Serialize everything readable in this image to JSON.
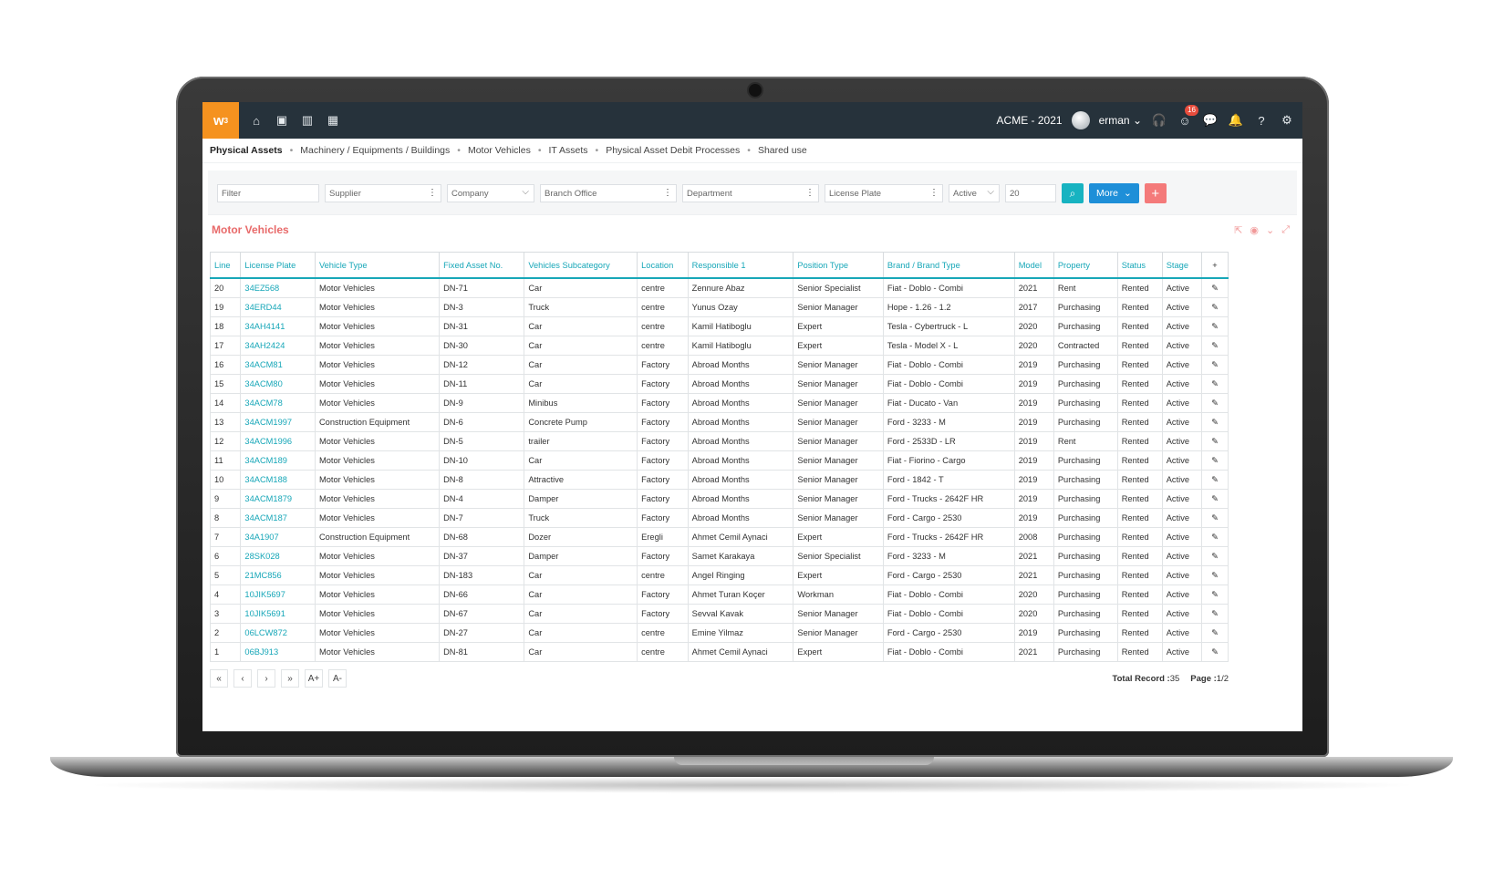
{
  "app": {
    "logo_text": "w",
    "logo_sup": "3",
    "company": "ACME - 2021",
    "user": "erman",
    "notifications": "16"
  },
  "nav_icons": [
    "home-icon",
    "briefcase-icon",
    "bar-chart-icon",
    "calendar-icon"
  ],
  "breadcrumb": [
    "Physical Assets",
    "Machinery / Equipments / Buildings",
    "Motor Vehicles",
    "IT Assets",
    "Physical Asset Debit Processes",
    "Shared use"
  ],
  "filters": {
    "filter": "Filter",
    "supplier": "Supplier",
    "company": "Company",
    "branch": "Branch Office",
    "department": "Department",
    "plate": "License Plate",
    "status": "Active",
    "page_size": "20",
    "more_label": "More"
  },
  "panel": {
    "title": "Motor Vehicles"
  },
  "table": {
    "headers": [
      "Line",
      "License Plate",
      "Vehicle Type",
      "Fixed Asset No.",
      "Vehicles Subcategory",
      "Location",
      "Responsible 1",
      "Position Type",
      "Brand / Brand Type",
      "Model",
      "Property",
      "Status",
      "Stage"
    ],
    "rows": [
      [
        "20",
        "34EZ568",
        "Motor Vehicles",
        "DN-71",
        "Car",
        "centre",
        "Zennure Abaz",
        "Senior Specialist",
        "Fiat - Doblo - Combi",
        "2021",
        "Rent",
        "Rented",
        "Active"
      ],
      [
        "19",
        "34ERD44",
        "Motor Vehicles",
        "DN-3",
        "Truck",
        "centre",
        "Yunus Ozay",
        "Senior Manager",
        "Hope - 1.26 - 1.2",
        "2017",
        "Purchasing",
        "Rented",
        "Active"
      ],
      [
        "18",
        "34AH4141",
        "Motor Vehicles",
        "DN-31",
        "Car",
        "centre",
        "Kamil Hatiboglu",
        "Expert",
        "Tesla - Cybertruck - L",
        "2020",
        "Purchasing",
        "Rented",
        "Active"
      ],
      [
        "17",
        "34AH2424",
        "Motor Vehicles",
        "DN-30",
        "Car",
        "centre",
        "Kamil Hatiboglu",
        "Expert",
        "Tesla - Model X - L",
        "2020",
        "Contracted",
        "Rented",
        "Active"
      ],
      [
        "16",
        "34ACM81",
        "Motor Vehicles",
        "DN-12",
        "Car",
        "Factory",
        "Abroad Months",
        "Senior Manager",
        "Fiat - Doblo - Combi",
        "2019",
        "Purchasing",
        "Rented",
        "Active"
      ],
      [
        "15",
        "34ACM80",
        "Motor Vehicles",
        "DN-11",
        "Car",
        "Factory",
        "Abroad Months",
        "Senior Manager",
        "Fiat - Doblo - Combi",
        "2019",
        "Purchasing",
        "Rented",
        "Active"
      ],
      [
        "14",
        "34ACM78",
        "Motor Vehicles",
        "DN-9",
        "Minibus",
        "Factory",
        "Abroad Months",
        "Senior Manager",
        "Fiat - Ducato - Van",
        "2019",
        "Purchasing",
        "Rented",
        "Active"
      ],
      [
        "13",
        "34ACM1997",
        "Construction Equipment",
        "DN-6",
        "Concrete Pump",
        "Factory",
        "Abroad Months",
        "Senior Manager",
        "Ford - 3233 - M",
        "2019",
        "Purchasing",
        "Rented",
        "Active"
      ],
      [
        "12",
        "34ACM1996",
        "Motor Vehicles",
        "DN-5",
        "trailer",
        "Factory",
        "Abroad Months",
        "Senior Manager",
        "Ford - 2533D - LR",
        "2019",
        "Rent",
        "Rented",
        "Active"
      ],
      [
        "11",
        "34ACM189",
        "Motor Vehicles",
        "DN-10",
        "Car",
        "Factory",
        "Abroad Months",
        "Senior Manager",
        "Fiat - Fiorino - Cargo",
        "2019",
        "Purchasing",
        "Rented",
        "Active"
      ],
      [
        "10",
        "34ACM188",
        "Motor Vehicles",
        "DN-8",
        "Attractive",
        "Factory",
        "Abroad Months",
        "Senior Manager",
        "Ford - 1842 - T",
        "2019",
        "Purchasing",
        "Rented",
        "Active"
      ],
      [
        "9",
        "34ACM1879",
        "Motor Vehicles",
        "DN-4",
        "Damper",
        "Factory",
        "Abroad Months",
        "Senior Manager",
        "Ford - Trucks - 2642F HR",
        "2019",
        "Purchasing",
        "Rented",
        "Active"
      ],
      [
        "8",
        "34ACM187",
        "Motor Vehicles",
        "DN-7",
        "Truck",
        "Factory",
        "Abroad Months",
        "Senior Manager",
        "Ford - Cargo - 2530",
        "2019",
        "Purchasing",
        "Rented",
        "Active"
      ],
      [
        "7",
        "34A1907",
        "Construction Equipment",
        "DN-68",
        "Dozer",
        "Eregli",
        "Ahmet Cemil Aynaci",
        "Expert",
        "Ford - Trucks - 2642F HR",
        "2008",
        "Purchasing",
        "Rented",
        "Active"
      ],
      [
        "6",
        "28SK028",
        "Motor Vehicles",
        "DN-37",
        "Damper",
        "Factory",
        "Samet Karakaya",
        "Senior Specialist",
        "Ford - 3233 - M",
        "2021",
        "Purchasing",
        "Rented",
        "Active"
      ],
      [
        "5",
        "21MC856",
        "Motor Vehicles",
        "DN-183",
        "Car",
        "centre",
        "Angel Ringing",
        "Expert",
        "Ford - Cargo - 2530",
        "2021",
        "Purchasing",
        "Rented",
        "Active"
      ],
      [
        "4",
        "10JIK5697",
        "Motor Vehicles",
        "DN-66",
        "Car",
        "Factory",
        "Ahmet Turan Koçer",
        "Workman",
        "Fiat - Doblo - Combi",
        "2020",
        "Purchasing",
        "Rented",
        "Active"
      ],
      [
        "3",
        "10JIK5691",
        "Motor Vehicles",
        "DN-67",
        "Car",
        "Factory",
        "Sevval Kavak",
        "Senior Manager",
        "Fiat - Doblo - Combi",
        "2020",
        "Purchasing",
        "Rented",
        "Active"
      ],
      [
        "2",
        "06LCW872",
        "Motor Vehicles",
        "DN-27",
        "Car",
        "centre",
        "Emine Yilmaz",
        "Senior Manager",
        "Ford - Cargo - 2530",
        "2019",
        "Purchasing",
        "Rented",
        "Active"
      ],
      [
        "1",
        "06BJ913",
        "Motor Vehicles",
        "DN-81",
        "Car",
        "centre",
        "Ahmet Cemil Aynaci",
        "Expert",
        "Fiat - Doblo - Combi",
        "2021",
        "Purchasing",
        "Rented",
        "Active"
      ]
    ]
  },
  "pager": {
    "buttons": [
      "«",
      "‹",
      "›",
      "»",
      "A+",
      "A-"
    ],
    "total_label": "Total Record :",
    "total_value": "35",
    "page_label": "Page :",
    "page_value": "1/2"
  },
  "colors": {
    "topbar": "#26323b",
    "logo": "#f5921f",
    "accent": "#17a7b8",
    "title": "#e86a6a",
    "more": "#1e8fd8",
    "add": "#f47a7a"
  }
}
